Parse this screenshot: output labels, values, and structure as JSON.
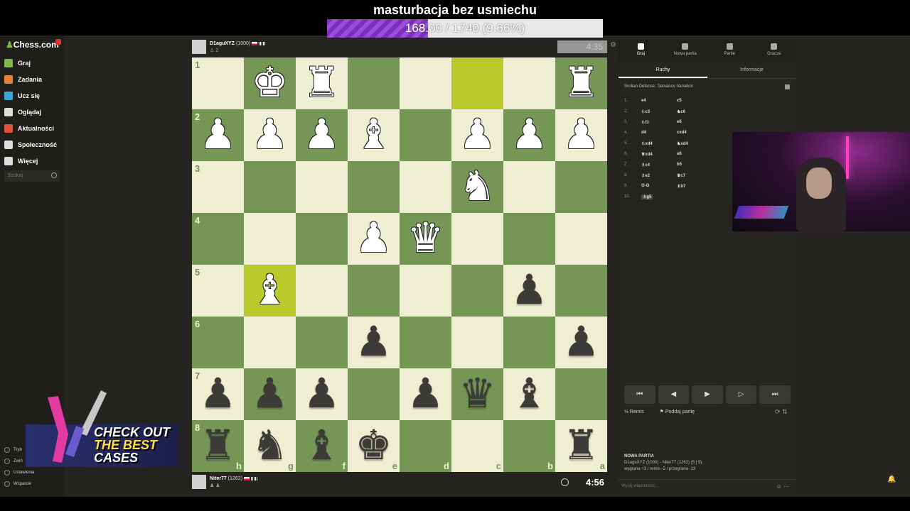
{
  "overlay": {
    "title": "masturbacja bez usmiechu",
    "goal_text": "168.00 / 1740 (9.66%)",
    "goal_fraction": 0.0966,
    "goal_color": "#7b2fbf"
  },
  "sidebar": {
    "logo": "Chess.com",
    "items": [
      {
        "label": "Graj",
        "icon": "play-icon",
        "color": "#81b64c"
      },
      {
        "label": "Zadania",
        "icon": "puzzle-icon",
        "color": "#e8803a"
      },
      {
        "label": "Ucz się",
        "icon": "learn-icon",
        "color": "#3aa6d8"
      },
      {
        "label": "Oglądaj",
        "icon": "watch-icon",
        "color": "#ddd"
      },
      {
        "label": "Aktualności",
        "icon": "news-icon",
        "color": "#e0503a"
      },
      {
        "label": "Społeczność",
        "icon": "community-icon",
        "color": "#ddd"
      },
      {
        "label": "Więcej",
        "icon": "more-icon",
        "color": "#ddd"
      }
    ],
    "search_placeholder": "Szukaj",
    "bottom": [
      "Tryb",
      "Zwiń",
      "Ustawienia",
      "Wsparcie"
    ]
  },
  "ad": {
    "line1": "CHECK OUT",
    "line2": "THE BEST",
    "line3": "CASES"
  },
  "top_player": {
    "name": "D1aguXYZ",
    "rating": "(1000)",
    "material": "♙ 2",
    "clock": "4:35"
  },
  "bottom_player": {
    "name": "Niter77",
    "rating": "(1262)",
    "material": "♟ ♟",
    "clock": "4:56"
  },
  "board": {
    "ranks": [
      "1",
      "2",
      "3",
      "4",
      "5",
      "6",
      "7",
      "8"
    ],
    "files": [
      "h",
      "g",
      "f",
      "e",
      "d",
      "c",
      "b",
      "a"
    ],
    "rows": [
      [
        " ",
        "K",
        "R",
        " ",
        " ",
        " ",
        " ",
        "R"
      ],
      [
        "P",
        "P",
        "P",
        "B",
        " ",
        "P",
        "P",
        "P"
      ],
      [
        " ",
        " ",
        " ",
        " ",
        " ",
        "N",
        " ",
        " "
      ],
      [
        " ",
        " ",
        " ",
        "P",
        "Q",
        " ",
        " ",
        " "
      ],
      [
        " ",
        "B",
        " ",
        " ",
        " ",
        " ",
        "p",
        " "
      ],
      [
        " ",
        " ",
        " ",
        "p",
        " ",
        " ",
        " ",
        "p"
      ],
      [
        "p",
        "p",
        "p",
        " ",
        "p",
        "q",
        "b",
        " "
      ],
      [
        "r",
        "n",
        "b",
        "k",
        " ",
        " ",
        " ",
        "r"
      ]
    ],
    "highlights": [
      [
        0,
        5
      ],
      [
        4,
        1
      ]
    ],
    "light_color": "#eeeed2",
    "dark_color": "#769656"
  },
  "panel": {
    "tabs": [
      "Graj",
      "Nowa partia",
      "Partie",
      "Gracze"
    ],
    "subtabs": [
      "Ruchy",
      "Informacje"
    ],
    "opening": "Sicilian Defense: Taimanov Variation",
    "moves": [
      {
        "n": "1.",
        "w": "e4",
        "b": "c5"
      },
      {
        "n": "2.",
        "w": "♘c3",
        "b": "♞c6"
      },
      {
        "n": "3.",
        "w": "♘f3",
        "b": "e6"
      },
      {
        "n": "4.",
        "w": "d4",
        "b": "cxd4"
      },
      {
        "n": "5.",
        "w": "♘xd4",
        "b": "♞xd4"
      },
      {
        "n": "6.",
        "w": "♕xd4",
        "b": "a6"
      },
      {
        "n": "7.",
        "w": "♗c4",
        "b": "b5"
      },
      {
        "n": "8.",
        "w": "♗e2",
        "b": "♛c7"
      },
      {
        "n": "9.",
        "w": "O-O",
        "b": "♝b7"
      },
      {
        "n": "10.",
        "w": "♗g5",
        "b": ""
      }
    ],
    "nav": [
      "⏮",
      "◀",
      "▶",
      "▷",
      "⏭"
    ],
    "draw": "Remis",
    "resign": "Poddaj partię",
    "newgame_title": "NOWA PARTIA",
    "newgame_line": "D1aguXYZ (1000) - Niter77 (1262) (5 | 5)",
    "newgame_stats": "wygrana +3 / remis -5 / przegrana -13",
    "chat_placeholder": "Wyślij wiadomość..."
  }
}
